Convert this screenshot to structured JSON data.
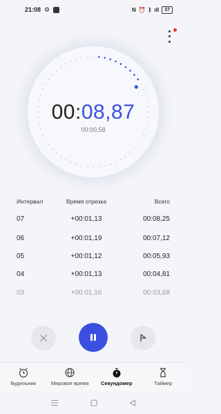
{
  "status_bar": {
    "time": "21:08",
    "icons": [
      "gear-icon",
      "app-icon",
      "nfc-icon",
      "alarm-icon",
      "bluetooth-icon",
      "signal-icon"
    ],
    "battery": "37"
  },
  "stopwatch": {
    "main_prefix": "00:",
    "main_accent": "08,87",
    "lap_time": "00:00,58",
    "accent_color": "#3b4fe0"
  },
  "laps": {
    "headers": [
      "Интервал",
      "Время отрезка",
      "Всего"
    ],
    "rows": [
      [
        "07",
        "+00:01,13",
        "00:08,25"
      ],
      [
        "06",
        "+00:01,19",
        "00:07,12"
      ],
      [
        "05",
        "+00:01,12",
        "00:05,93"
      ],
      [
        "04",
        "+00:01,13",
        "00:04,81"
      ],
      [
        "03",
        "+00:01,16",
        "00:03,68"
      ]
    ]
  },
  "controls": {
    "reset_icon": "close-icon",
    "pause_icon": "pause-icon",
    "lap_icon": "flag-icon"
  },
  "tabs": [
    {
      "label": "Будильник",
      "icon": "alarm-clock-icon"
    },
    {
      "label": "Мировое время",
      "icon": "globe-icon"
    },
    {
      "label": "Секундомер",
      "icon": "stopwatch-icon",
      "active": true
    },
    {
      "label": "Таймер",
      "icon": "hourglass-icon"
    }
  ]
}
